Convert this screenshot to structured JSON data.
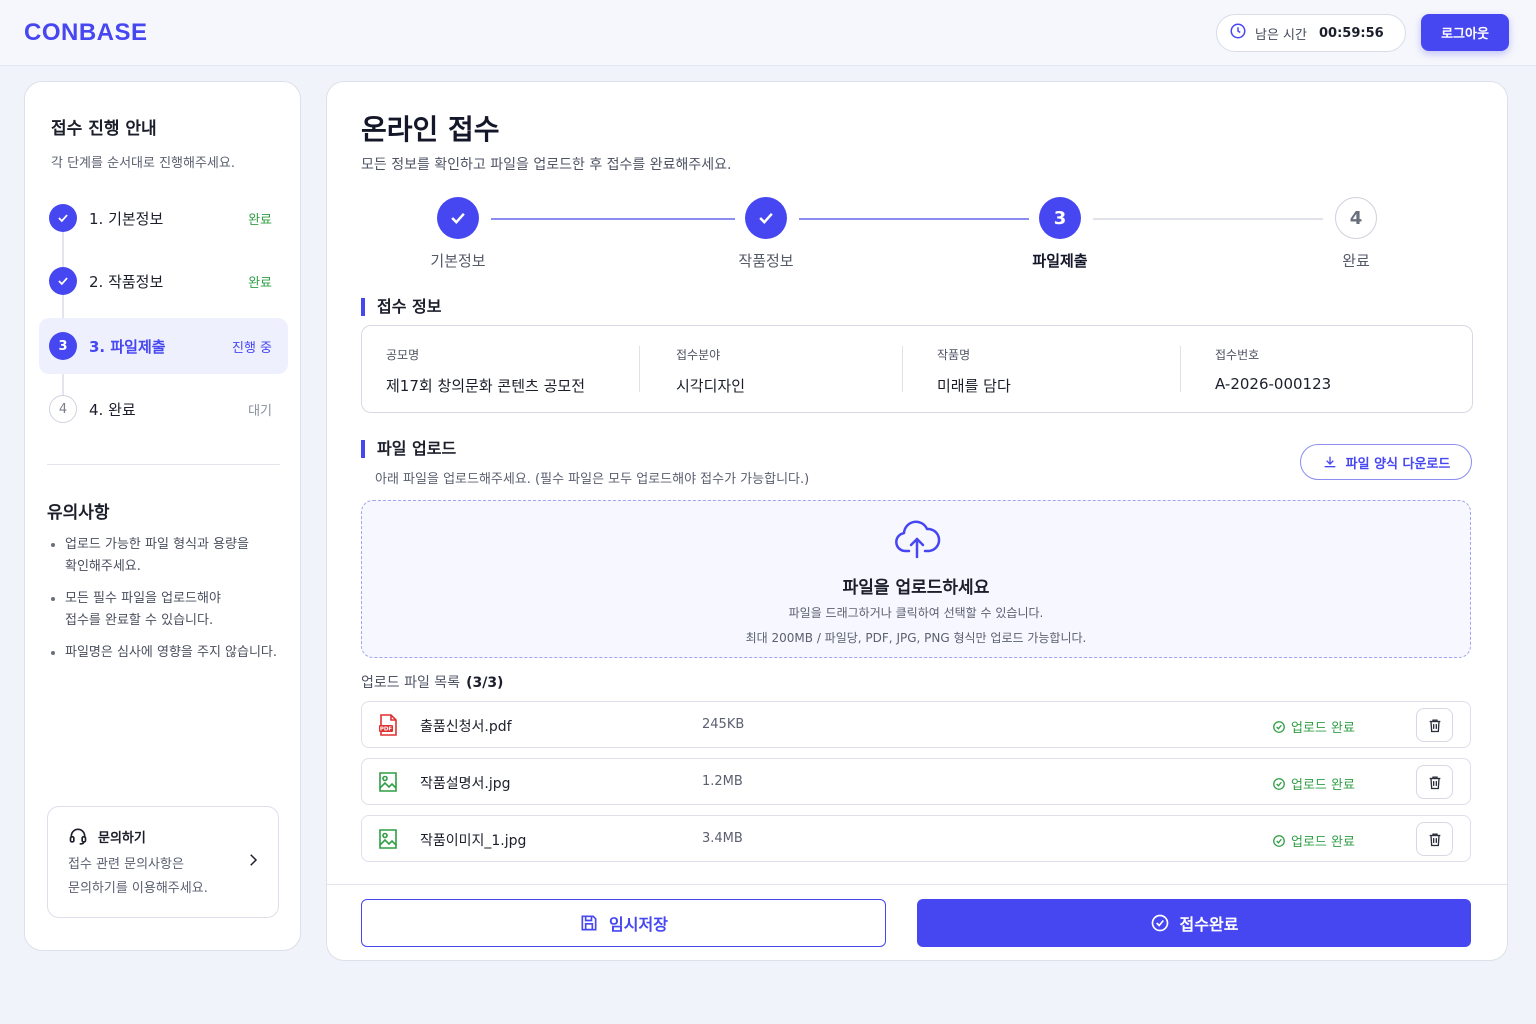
{
  "header": {
    "logo": "CONBASE",
    "timer_label": "남은 시간",
    "timer_value": "00:59:56",
    "logout_label": "로그아웃"
  },
  "sidebar": {
    "title": "접수 진행 안내",
    "desc": "각 단계를 순서대로 진행해주세요.",
    "steps": [
      {
        "num": "1",
        "label": "1. 기본정보",
        "status": "완료"
      },
      {
        "num": "2",
        "label": "2. 작품정보",
        "status": "완료"
      },
      {
        "num": "3",
        "label": "3. 파일제출",
        "status": "진행 중"
      },
      {
        "num": "4",
        "label": "4. 완료",
        "status": "대기"
      }
    ],
    "notice_title": "유의사항",
    "notes": [
      "업로드 가능한 파일 형식과 용량을\n확인해주세요.",
      "모든 필수 파일을 업로드해야\n접수를 완료할 수 있습니다.",
      "파일명은 심사에 영향을 주지 않습니다."
    ],
    "help": {
      "title": "문의하기",
      "desc": "접수 관련 문의사항은\n문의하기를 이용해주세요."
    }
  },
  "main": {
    "title": "온라인 접수",
    "desc": "모든 정보를 확인하고 파일을 업로드한 후 접수를 완료해주세요.",
    "stepper": [
      {
        "num": "1",
        "label": "기본정보"
      },
      {
        "num": "2",
        "label": "작품정보"
      },
      {
        "num": "3",
        "label": "파일제출"
      },
      {
        "num": "4",
        "label": "완료"
      }
    ],
    "info_section_title": "접수 정보",
    "info": [
      {
        "key": "공모명",
        "value": "제17회 창의문화 콘텐츠 공모전"
      },
      {
        "key": "접수분야",
        "value": "시각디자인"
      },
      {
        "key": "작품명",
        "value": "미래를 담다"
      },
      {
        "key": "접수번호",
        "value": "A-2026-000123"
      }
    ],
    "upload_section_title": "파일 업로드",
    "upload_desc": "아래 파일을 업로드해주세요. (필수 파일은 모두 업로드해야 접수가 가능합니다.)",
    "download_label": "파일 양식 다운로드",
    "dropzone": {
      "title": "파일을 업로드하세요",
      "sub": "파일을 드래그하거나 클릭하여 선택할 수 있습니다.",
      "limit": "최대 200MB / 파일당, PDF, JPG, PNG 형식만 업로드 가능합니다."
    },
    "list_title": "업로드 파일 목록",
    "list_count": "(3/3)",
    "files": [
      {
        "name": "출품신청서.pdf",
        "size": "245KB",
        "status": "업로드 완료",
        "icon": "pdf-file-icon"
      },
      {
        "name": "작품설명서.jpg",
        "size": "1.2MB",
        "status": "업로드 완료",
        "icon": "image-file-icon"
      },
      {
        "name": "작품이미지_1.jpg",
        "size": "3.4MB",
        "status": "업로드 완료",
        "icon": "image-file-icon"
      }
    ],
    "save_label": "임시저장",
    "submit_label": "접수완료"
  },
  "colors": {
    "accent": "#4747f2",
    "success": "#2f9e44",
    "pdf": "#e03131"
  }
}
